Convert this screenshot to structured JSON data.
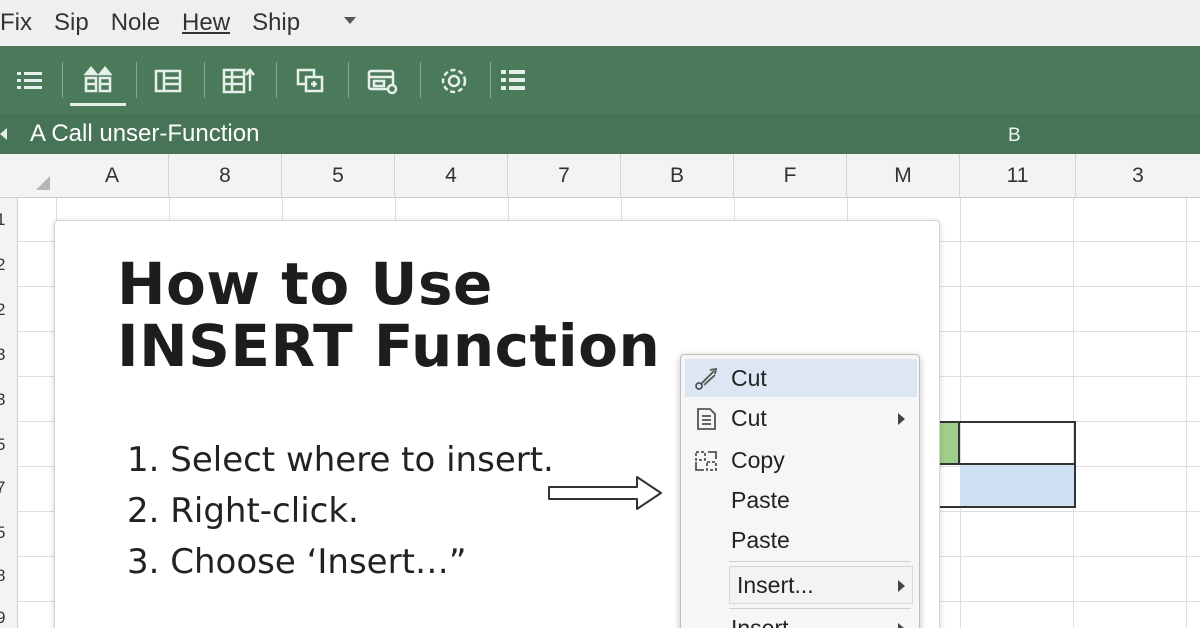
{
  "menu": {
    "items": [
      "Fix",
      "Sip",
      "Nole",
      "Hew",
      "Ship"
    ]
  },
  "toolbar": {
    "icons": [
      "list-icon",
      "sort-icon",
      "table-icon",
      "columns-icon",
      "copy-icon",
      "print-icon",
      "settings-icon",
      "grid-icon"
    ]
  },
  "formula_bar": {
    "text": "A Call unser-Function",
    "right_label": "B"
  },
  "columns": [
    "A",
    "8",
    "5",
    "4",
    "7",
    "B",
    "F",
    "M",
    "11",
    "3"
  ],
  "rows": [
    "1",
    "2",
    "2",
    "3",
    "3",
    "5",
    "7",
    "5",
    "8",
    "9"
  ],
  "card": {
    "title_line1": "How to Use",
    "title_line2": "INSERT Function",
    "steps": [
      "1. Select where to insert.",
      "2. Right-click.",
      "3. Choose ‘Insert…”"
    ]
  },
  "context_menu": {
    "items": [
      {
        "label": "Cut",
        "icon": "scissors-icon"
      },
      {
        "label": "Cut",
        "icon": "document-icon"
      },
      {
        "label": "Copy",
        "icon": "copy-icon"
      },
      {
        "label": "Paste",
        "icon": ""
      },
      {
        "label": "Paste",
        "icon": ""
      },
      {
        "label": "Insert...",
        "icon": ""
      },
      {
        "label": "Insert",
        "icon": ""
      }
    ]
  },
  "colors": {
    "toolbar": "#4b7a5a",
    "formula_bar": "#477357",
    "highlight": "#dce7f3",
    "cell_green": "#9fce8a",
    "cell_blue": "#cfe0f3"
  }
}
